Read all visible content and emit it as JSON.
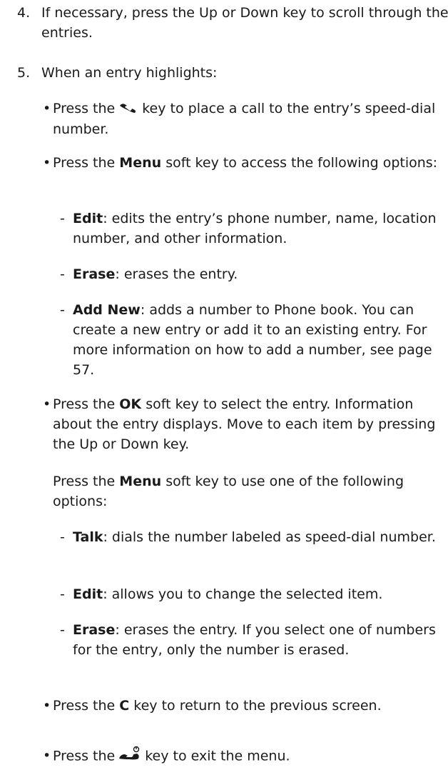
{
  "step4": {
    "number": "4.",
    "text": "If necessary, press the Up or Down key to scroll through the entries."
  },
  "step5": {
    "number": "5.",
    "text": "When an entry highlights:"
  },
  "bullet_call": {
    "pre": "Press the",
    "icon": "talk-key-icon",
    "post": "key to place a call to the entry’s speed-dial number."
  },
  "bullet_menu": {
    "pre": "Press the",
    "bold": "Menu",
    "post": "soft key to access the following options:"
  },
  "menu_options": [
    {
      "label": "Edit",
      "desc": ": edits the entry’s phone number, name, location number, and other information."
    },
    {
      "label": "Erase",
      "desc": ": erases the entry."
    },
    {
      "label": "Add New",
      "desc": ": adds a number to Phone book. You can create a new entry or add it to an existing entry. For more information on how to add a number, see page 57."
    }
  ],
  "bullet_ok": {
    "pre": "Press the",
    "bold": "OK",
    "post": "soft key to select the entry. Information about the entry displays. Move to each item by pressing the Up or Down key."
  },
  "ok_para": {
    "pre": "Press the",
    "bold": "Menu",
    "post": "soft key to use one of the following options:"
  },
  "ok_options": [
    {
      "label": "Talk",
      "desc": ": dials the number labeled as speed-dial number."
    },
    {
      "label": "Edit",
      "desc": ": allows you to change the selected item."
    },
    {
      "label": "Erase",
      "desc": ": erases the entry. If you select one of numbers for the entry, only the number is erased."
    }
  ],
  "bullet_c": {
    "pre": "Press the",
    "bold": "C",
    "post": "key to return to the previous screen."
  },
  "bullet_end": {
    "pre": "Press the",
    "icon": "end-key-icon",
    "post": "key to exit the menu."
  },
  "bullet_char": "•",
  "dash_char": "-"
}
